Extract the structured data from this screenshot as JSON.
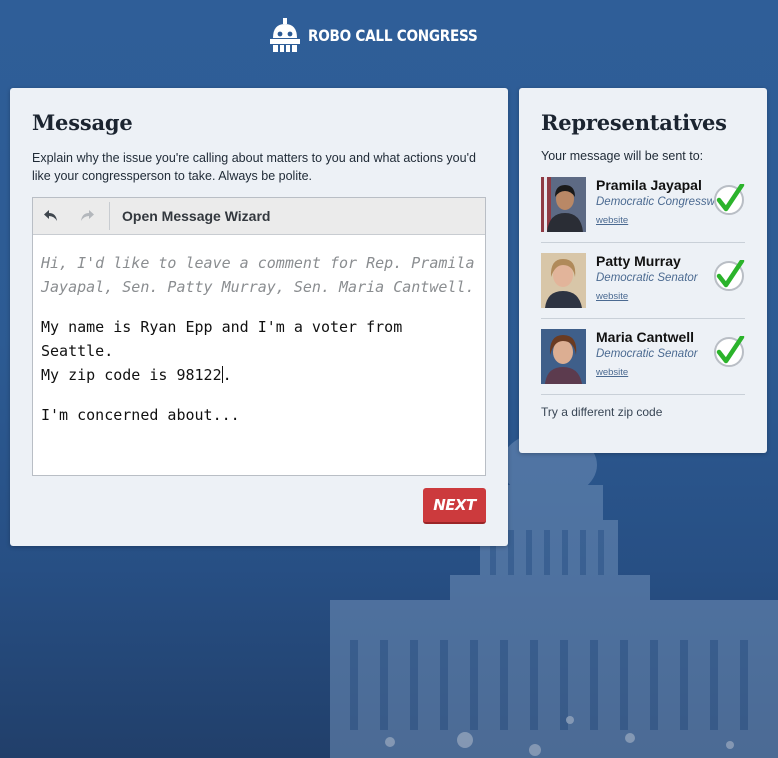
{
  "brand": {
    "name": "ROBO CALL CONGRESS"
  },
  "message": {
    "heading": "Message",
    "instructions": "Explain why the issue you're calling about matters to you and what actions you'd like your congressperson to take. Always be polite.",
    "toolbar": {
      "wizard_label": "Open Message Wizard"
    },
    "greeting": "Hi, I'd like to leave a comment for Rep. Pramila Jayapal, Sen. Patty Murray, Sen. Maria Cantwell.",
    "intro_line1": "My name is Ryan Epp and I'm a voter from Seattle.",
    "intro_line2_before_caret": "My zip code is 98122",
    "intro_line2_after_caret": ".",
    "concern": "I'm concerned about...",
    "next_label": "NEXT"
  },
  "representatives": {
    "heading": "Representatives",
    "subheading": "Your message will be sent to:",
    "items": [
      {
        "name": "Pramila Jayapal",
        "title": "Democratic Congresswoman",
        "link": "website"
      },
      {
        "name": "Patty Murray",
        "title": "Democratic Senator",
        "link": "website"
      },
      {
        "name": "Maria Cantwell",
        "title": "Democratic Senator",
        "link": "website"
      }
    ],
    "zip_link": "Try a different zip code"
  },
  "colors": {
    "accent_red": "#cc3a3d",
    "check_green": "#2bb32b",
    "background_blue": "#2b5a94"
  }
}
